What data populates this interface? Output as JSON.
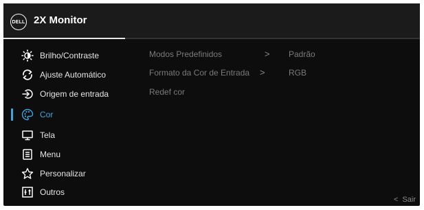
{
  "header": {
    "logo_text": "DELL",
    "title": "2X Monitor"
  },
  "menu": {
    "items": [
      {
        "label": "Brilho/Contraste",
        "icon": "brightness-icon"
      },
      {
        "label": "Ajuste Automático",
        "icon": "auto-adjust-icon"
      },
      {
        "label": "Origem de entrada",
        "icon": "input-source-icon"
      },
      {
        "label": "Cor",
        "icon": "palette-icon",
        "selected": true
      },
      {
        "label": "Tela",
        "icon": "display-icon"
      },
      {
        "label": "Menu",
        "icon": "menu-list-icon"
      },
      {
        "label": "Personalizar",
        "icon": "star-icon"
      },
      {
        "label": "Outros",
        "icon": "others-icon"
      }
    ]
  },
  "options": {
    "items": [
      {
        "label": "Modos Predefinidos",
        "chevron": ">",
        "value": "Padrão"
      },
      {
        "label": "Formato da Cor de Entrada",
        "chevron": ">",
        "value": "RGB"
      },
      {
        "label": "Redef cor"
      }
    ]
  },
  "footer": {
    "exit_chevron": "<",
    "exit_label": "Sair"
  },
  "colors": {
    "accent": "#41a6e0",
    "background": "#0d0d0d",
    "header": "#1b1b1b"
  }
}
